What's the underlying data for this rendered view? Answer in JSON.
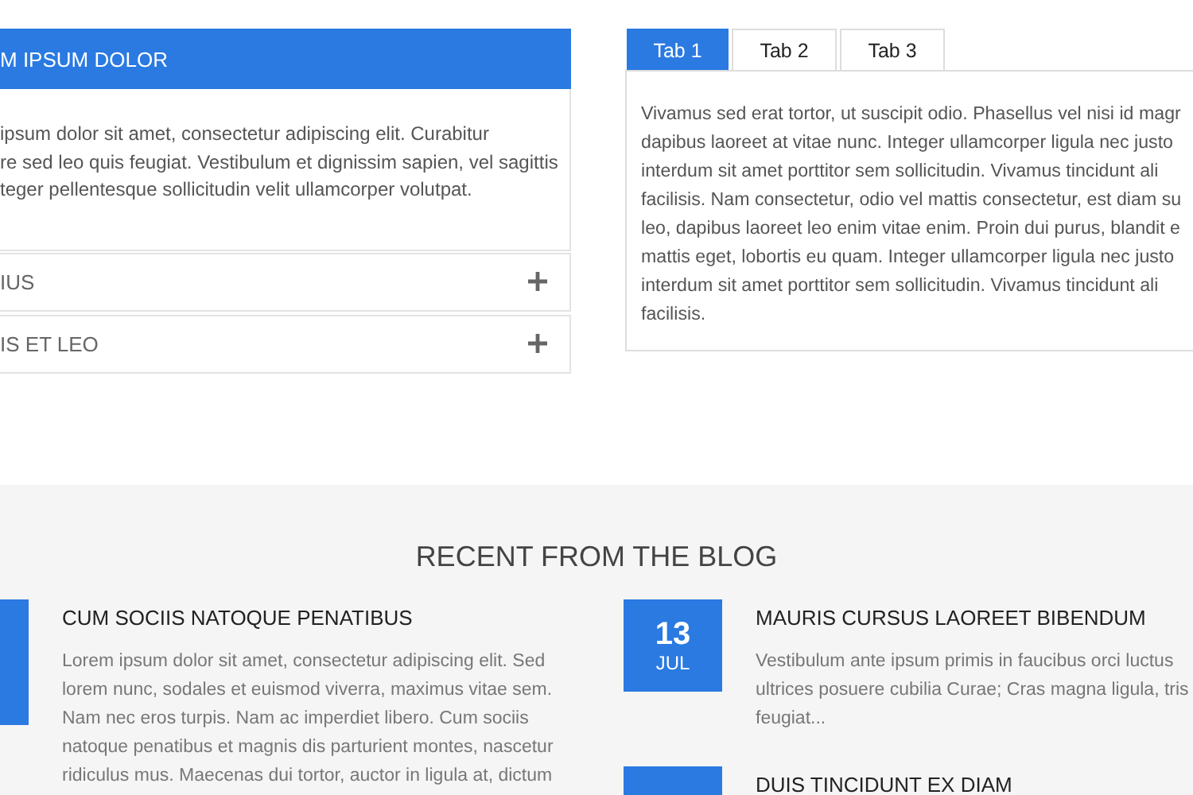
{
  "accordion": {
    "items": [
      {
        "title": "M IPSUM DOLOR",
        "expanded": true,
        "body_lines": [
          "ipsum dolor sit amet, consectetur adipiscing elit. Curabitur",
          "re sed leo quis feugiat. Vestibulum et dignissim sapien, vel sagittis",
          "teger pellentesque sollicitudin velit ullamcorper volutpat."
        ]
      },
      {
        "title": "IUS",
        "expanded": false
      },
      {
        "title": "IS ET LEO",
        "expanded": false
      }
    ]
  },
  "tabs": [
    {
      "label": "Tab 1",
      "selected": true
    },
    {
      "label": "Tab 2",
      "selected": false
    },
    {
      "label": "Tab 3",
      "selected": false
    }
  ],
  "tab_content_lines": [
    "Vivamus sed erat tortor, ut suscipit odio. Phasellus vel nisi id magr",
    "dapibus laoreet at vitae nunc. Integer ullamcorper ligula nec justo",
    "interdum sit amet porttitor sem sollicitudin. Vivamus tincidunt ali",
    "facilisis. Nam consectetur, odio vel mattis consectetur, est diam su",
    "leo, dapibus laoreet leo enim vitae enim. Proin dui purus, blandit e",
    "mattis eget, lobortis eu quam. Integer ullamcorper ligula nec justo",
    "interdum sit amet porttitor sem sollicitudin. Vivamus tincidunt ali",
    "facilisis."
  ],
  "blog": {
    "heading": "RECENT FROM THE BLOG",
    "posts": [
      {
        "title": "CUM SOCIIS NATOQUE PENATIBUS",
        "excerpt_lines": [
          "Lorem ipsum dolor sit amet, consectetur adipiscing elit. Sed",
          "lorem nunc, sodales et euismod viverra, maximus vitae sem.",
          "Nam nec eros turpis. Nam ac imperdiet libero. Cum sociis",
          "natoque penatibus et magnis dis parturient montes, nascetur",
          "ridiculus mus. Maecenas dui tortor, auctor in ligula at, dictum"
        ]
      },
      {
        "day": "13",
        "month": "JUL",
        "title": "MAURIS CURSUS LAOREET BIBENDUM",
        "excerpt_lines": [
          "Vestibulum ante ipsum primis in faucibus orci luctus",
          "ultrices posuere cubilia Curae; Cras magna ligula, tris",
          "feugiat..."
        ]
      },
      {
        "title": "DUIS TINCIDUNT EX DIAM"
      }
    ]
  }
}
